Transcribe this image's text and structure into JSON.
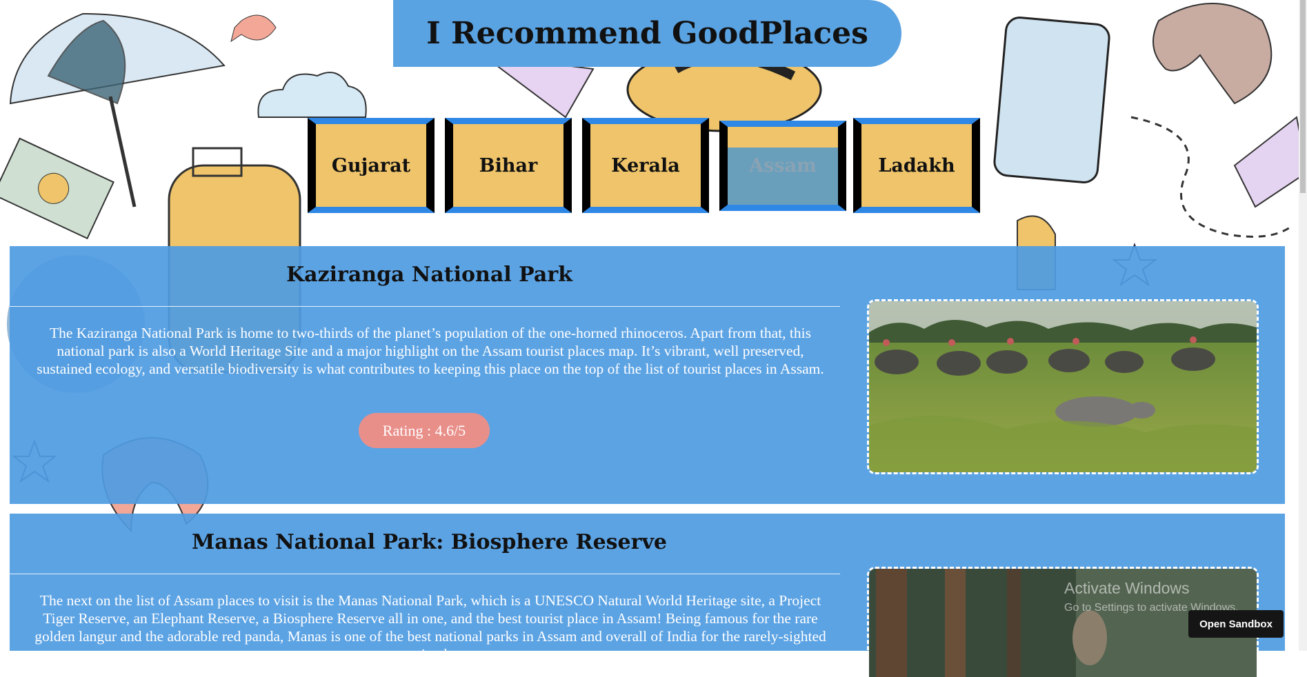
{
  "header": {
    "title": "I Recommend GoodPlaces"
  },
  "tabs": [
    {
      "label": "Gujarat",
      "active": false
    },
    {
      "label": "Bihar",
      "active": false
    },
    {
      "label": "Kerala",
      "active": false
    },
    {
      "label": "Assam",
      "active": true
    },
    {
      "label": "Ladakh",
      "active": false
    }
  ],
  "places": [
    {
      "name": "Kaziranga National Park",
      "description": "The Kaziranga National Park is home to two-thirds of the planet’s population of the one-horned rhinoceros. Apart from that, this national park is also a World Heritage Site and a major highlight on the Assam tourist places map. It’s vibrant, well preserved, sustained ecology, and versatile biodiversity is what contributes to keeping this place on the top of the list of tourist places in Assam.",
      "rating": "Rating : 4.6/5"
    },
    {
      "name": "Manas National Park: Biosphere Reserve",
      "description": "The next on the list of Assam places to visit is the Manas National Park, which is a UNESCO Natural World Heritage site, a Project Tiger Reserve, an Elephant Reserve, a Biosphere Reserve all in one, and the best tourist place in Assam! Being famous for the rare golden langur and the adorable red panda, Manas is one of the best national parks in Assam and overall of India for the rarely-sighted animals"
    }
  ],
  "overlay": {
    "activate_title": "Activate Windows",
    "activate_sub": "Go to Settings to activate Windows.",
    "sandbox_button": "Open Sandbox"
  },
  "colors": {
    "accent_blue": "#5aa3e2",
    "tab_yellow": "#efc46a",
    "tab_border_blue": "#2f88e6",
    "rating_pink": "#e98f8a"
  }
}
